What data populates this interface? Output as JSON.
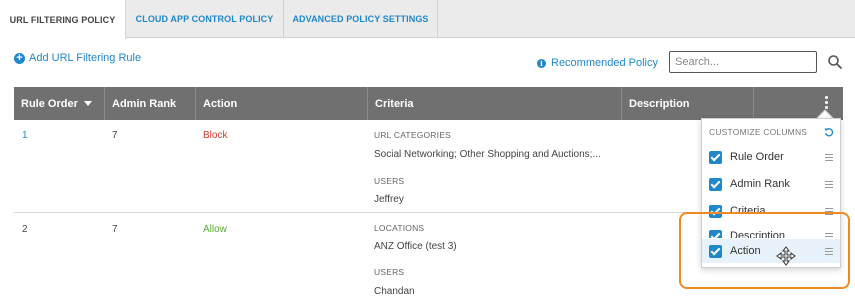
{
  "tabs": [
    {
      "label": "URL FILTERING POLICY"
    },
    {
      "label": "CLOUD APP CONTROL POLICY"
    },
    {
      "label": "ADVANCED POLICY SETTINGS"
    }
  ],
  "toolbar": {
    "add_rule_label": "Add URL Filtering Rule",
    "recommended_label": "Recommended Policy",
    "search_placeholder": "Search..."
  },
  "table": {
    "columns": [
      "Rule Order",
      "Admin Rank",
      "Action",
      "Criteria",
      "Description"
    ],
    "rows": [
      {
        "rule_order": "1",
        "admin_rank": "7",
        "action": "Block",
        "criteria": [
          {
            "label": "URL CATEGORIES",
            "value": "Social Networking; Other Shopping and Auctions;..."
          },
          {
            "label": "USERS",
            "value": "Jeffrey"
          }
        ]
      },
      {
        "rule_order": "2",
        "admin_rank": "7",
        "action": "Allow",
        "criteria": [
          {
            "label": "LOCATIONS",
            "value": "ANZ Office (test 3)"
          },
          {
            "label": "USERS",
            "value": "Chandan"
          }
        ]
      }
    ]
  },
  "customize": {
    "title": "CUSTOMIZE COLUMNS",
    "items": [
      {
        "label": "Rule Order",
        "checked": true
      },
      {
        "label": "Admin Rank",
        "checked": true
      },
      {
        "label": "Criteria",
        "checked": true
      },
      {
        "label": "Description",
        "checked": true
      },
      {
        "label": "Action",
        "checked": true
      }
    ]
  },
  "colors": {
    "accent": "#1f88c8",
    "header_bg": "#707070",
    "block": "#d23b2a",
    "allow": "#5aab2f",
    "highlight": "#f08a24"
  }
}
